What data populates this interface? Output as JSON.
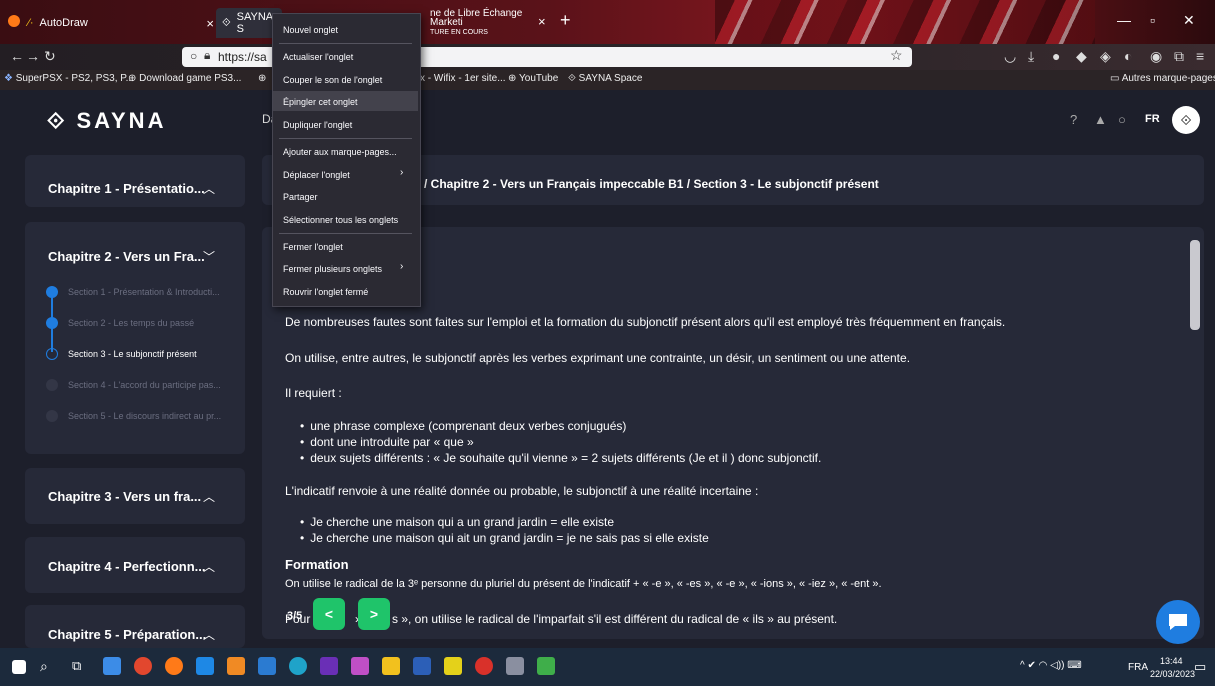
{
  "browser": {
    "tabs": [
      {
        "title": "AutoDraw",
        "close": "×"
      },
      {
        "title": "SAYNA S"
      },
      {
        "title": "ne de Libre Échange Marketi",
        "subtitle": "TURE EN COURS",
        "close": "×"
      }
    ],
    "new_tab": "+",
    "url": "https://sa",
    "bookmarks": [
      "SuperPSX - PS2, PS3, P...",
      "Download game PS3...",
      "x - Wifix - 1er site...",
      "YouTube",
      "SAYNA Space"
    ],
    "other_bookmarks": "Autres marque-pages"
  },
  "context_menu": {
    "items": [
      "Nouvel onglet",
      "Actualiser l'onglet",
      "Couper le son de l'onglet",
      "Épingler cet onglet",
      "Dupliquer l'onglet",
      "Ajouter aux marque-pages...",
      "Déplacer l'onglet",
      "Partager",
      "Sélectionner tous les onglets",
      "Fermer l'onglet",
      "Fermer plusieurs onglets",
      "Rouvrir l'onglet fermé"
    ],
    "highlighted": "Épingler cet onglet"
  },
  "header": {
    "logo": "SAYNA",
    "nav_partial": "Da",
    "lang": "FR"
  },
  "sidebar": {
    "chapters": [
      {
        "title": "Chapitre 1 - Présentatio...",
        "chevron": "^"
      },
      {
        "title": "Chapitre 2 - Vers un Fra...",
        "chevron": "v"
      },
      {
        "title": "Chapitre 3 - Vers un fra...",
        "chevron": "^"
      },
      {
        "title": "Chapitre 4 - Perfectionn...",
        "chevron": "^"
      },
      {
        "title": "Chapitre 5 - Préparation...",
        "chevron": "^"
      }
    ],
    "sections": [
      {
        "label": "Section 1 - Présentation & Introducti...",
        "state": "done"
      },
      {
        "label": "Section 2 - Les temps du passé",
        "state": "done"
      },
      {
        "label": "Section 3 - Le subjonctif présent",
        "state": "current"
      },
      {
        "label": "Section 4 - L'accord du participe pas...",
        "state": "todo"
      },
      {
        "label": "Section 5 - Le discours indirect au pr...",
        "state": "todo"
      }
    ]
  },
  "breadcrumb": "/ Chapitre 2 - Vers un Français impeccable B1 / Section 3 - Le subjonctif présent",
  "content": {
    "p1": "De nombreuses fautes sont faites sur l'emploi et la formation du subjonctif présent alors qu'il est employé très fréquemment en français.",
    "p2": "On utilise, entre autres, le subjonctif après les verbes exprimant une contrainte, un désir, un sentiment ou une attente.",
    "p3": "Il requiert :",
    "list1": [
      "une phrase complexe (comprenant deux verbes conjugués)",
      "dont une introduite par « que »",
      "deux sujets différents : « Je souhaite qu'il vienne » = 2 sujets différents (Je et il ) donc subjonctif."
    ],
    "p4": "L'indicatif renvoie à une réalité donnée ou probable, le subjonctif à une réalité incertaine :",
    "list2": [
      "Je cherche une maison qui a un grand jardin = elle existe",
      "Je cherche une maison qui ait un grand jardin = je ne sais pas si elle existe"
    ],
    "formation_title": "Formation",
    "p5": "On utilise le radical de la 3ᵉ personne du pluriel du présent de l'indicatif + « -e », « -es », « -e », « -ions », « -iez », « -ent ».",
    "p6_start": "Pour «",
    "p6_mid": "» e",
    "p6_end": "s », on utilise le radical de l'imparfait s'il est différent du radical de « ils » au présent.",
    "pager": "3/5",
    "prev": "<",
    "next": ">"
  },
  "taskbar": {
    "lang": "FRA",
    "time": "13:44",
    "date": "22/03/2023"
  }
}
